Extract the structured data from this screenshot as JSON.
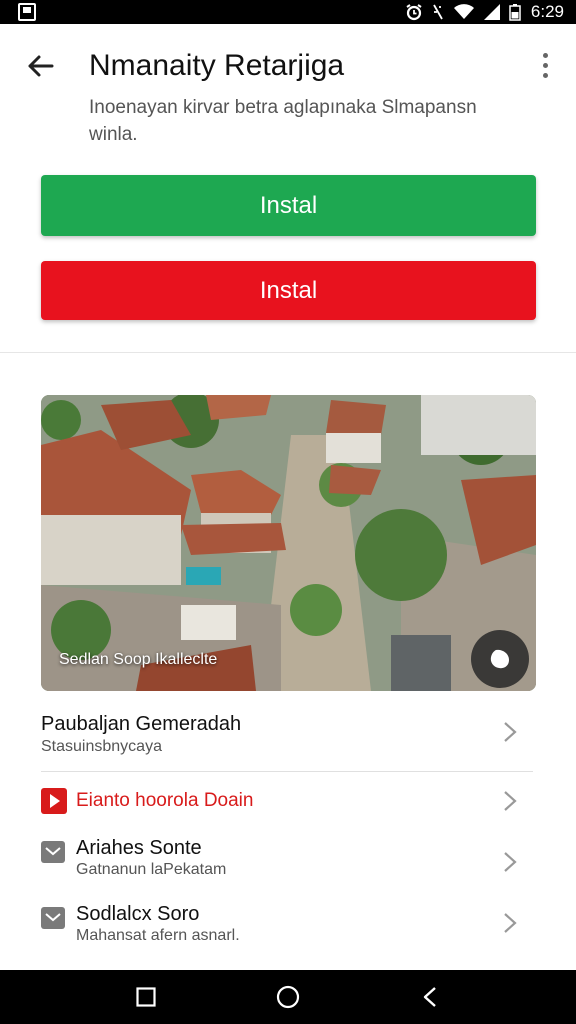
{
  "status_bar": {
    "time": "6:29",
    "icons": [
      "notification-icon",
      "alarm-icon",
      "vibrate-icon",
      "wifi-icon",
      "signal-icon",
      "battery-icon"
    ]
  },
  "header": {
    "title": "Nmanaity Retarjiga",
    "subtitle": "Inoenayan kirvar betra aglapınaka Slmapansn winla."
  },
  "actions": {
    "primary_label": "Instal",
    "secondary_label": "Instal",
    "primary_color": "#1ea851",
    "secondary_color": "#e8121e"
  },
  "photo": {
    "caption": "Sedlan Soop Ikalleclte",
    "fab_icon": "shape-icon"
  },
  "list": {
    "items": [
      {
        "title": "Paubaljan Gemeradah",
        "subtitle": "Stasuinsbnycaya",
        "icon": ""
      },
      {
        "title": "Eianto hoorola Doain",
        "subtitle": "",
        "icon": "youtube-icon",
        "title_color": "#d81b1b"
      },
      {
        "title": "Ariahes Sonte",
        "subtitle": "Gatnanun laPekatam",
        "icon": "mail-icon"
      },
      {
        "title": "Sodlalcx Soro",
        "subtitle": "Mahansat afern asnarl.",
        "icon": "mail-icon"
      }
    ]
  }
}
